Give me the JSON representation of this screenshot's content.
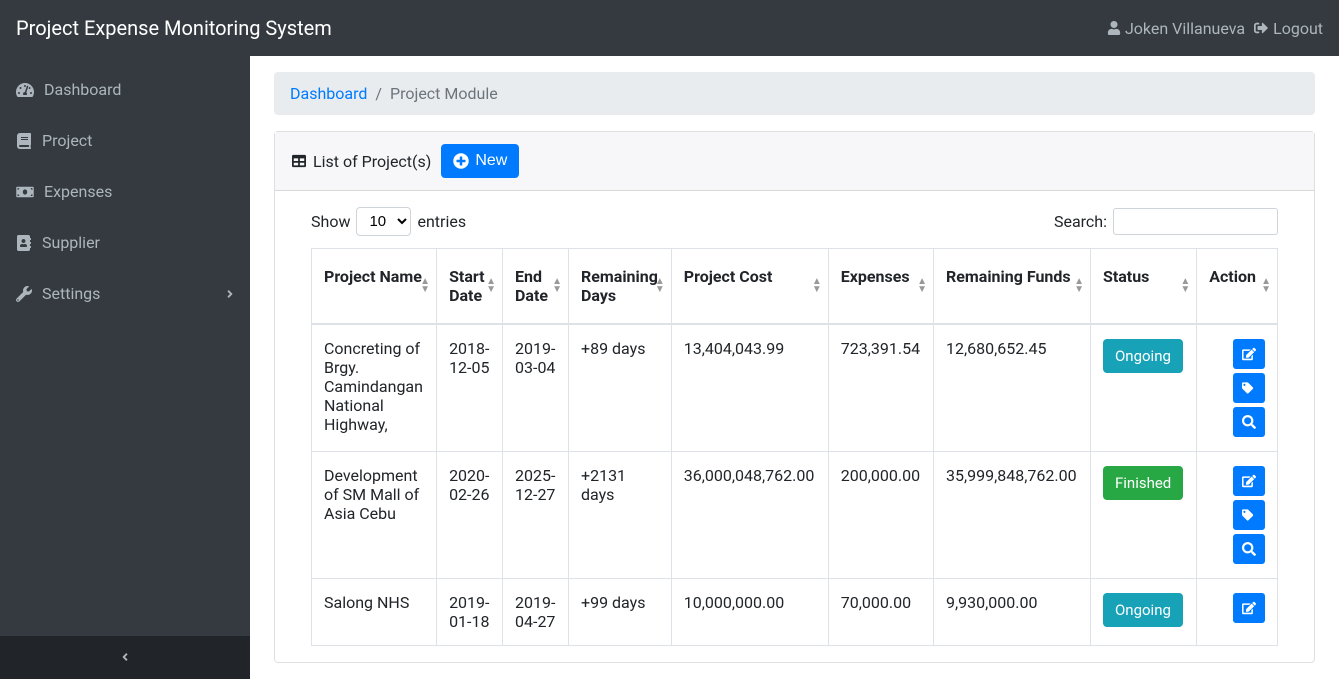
{
  "header": {
    "brand": "Project Expense Monitoring System",
    "user": "Joken Villanueva",
    "logout": "Logout"
  },
  "sidebar": {
    "items": [
      {
        "label": "Dashboard"
      },
      {
        "label": "Project"
      },
      {
        "label": "Expenses"
      },
      {
        "label": "Supplier"
      },
      {
        "label": "Settings"
      }
    ]
  },
  "breadcrumb": {
    "home": "Dashboard",
    "current": "Project Module"
  },
  "card": {
    "title": "List of Project(s)",
    "new_label": "New"
  },
  "datatable": {
    "show_label": "Show",
    "entries_label": "entries",
    "length_value": "10",
    "search_label": "Search:",
    "columns": [
      "Project Name",
      "Start Date",
      "End Date",
      "Remaining Days",
      "Project Cost",
      "Expenses",
      "Remaining Funds",
      "Status",
      "Action"
    ],
    "rows": [
      {
        "name": "Concreting of Brgy. Camindangan National Highway,",
        "start": "2018-12-05",
        "end": "2019-03-04",
        "remaining": "+89 days",
        "cost": "13,404,043.99",
        "expenses": "723,391.54",
        "funds": "12,680,652.45",
        "status": "Ongoing"
      },
      {
        "name": "Development of SM Mall of Asia Cebu",
        "start": "2020-02-26",
        "end": "2025-12-27",
        "remaining": "+2131 days",
        "cost": "36,000,048,762.00",
        "expenses": "200,000.00",
        "funds": "35,999,848,762.00",
        "status": "Finished"
      },
      {
        "name": "Salong NHS",
        "start": "2019-01-18",
        "end": "2019-04-27",
        "remaining": "+99 days",
        "cost": "10,000,000.00",
        "expenses": "70,000.00",
        "funds": "9,930,000.00",
        "status": "Ongoing"
      }
    ]
  }
}
